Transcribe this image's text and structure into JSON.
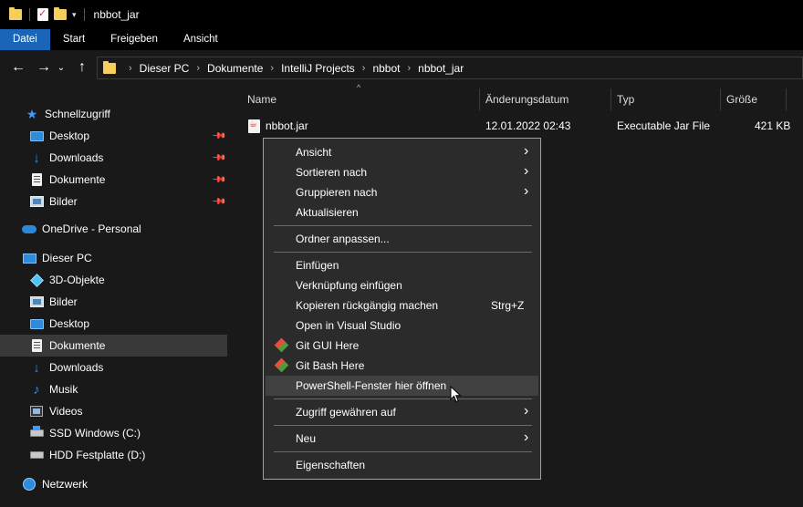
{
  "window": {
    "title": "nbbot_jar"
  },
  "ribbon": {
    "tabs": [
      "Datei",
      "Start",
      "Freigeben",
      "Ansicht"
    ]
  },
  "address": {
    "crumbs": [
      "Dieser PC",
      "Dokumente",
      "IntelliJ Projects",
      "nbbot",
      "nbbot_jar"
    ]
  },
  "sidebar": {
    "quick_access": "Schnellzugriff",
    "quick_items": [
      "Desktop",
      "Downloads",
      "Dokumente",
      "Bilder"
    ],
    "onedrive": "OneDrive - Personal",
    "this_pc": "Dieser PC",
    "pc_items": [
      "3D-Objekte",
      "Bilder",
      "Desktop",
      "Dokumente",
      "Downloads",
      "Musik",
      "Videos",
      "SSD Windows (C:)",
      "HDD Festplatte (D:)"
    ],
    "network": "Netzwerk",
    "selected": "Dokumente"
  },
  "columns": {
    "name": "Name",
    "date": "Änderungsdatum",
    "type": "Typ",
    "size": "Größe"
  },
  "files": [
    {
      "name": "nbbot.jar",
      "date": "12.01.2022 02:43",
      "type": "Executable Jar File",
      "size": "421 KB"
    }
  ],
  "context_menu": {
    "ansicht": "Ansicht",
    "sortieren": "Sortieren nach",
    "gruppieren": "Gruppieren nach",
    "aktualisieren": "Aktualisieren",
    "ordner_anpassen": "Ordner anpassen...",
    "einfuegen": "Einfügen",
    "verknuepfung": "Verknüpfung einfügen",
    "kopieren_rueck": "Kopieren rückgängig machen",
    "kopieren_rueck_shortcut": "Strg+Z",
    "open_vs": "Open in Visual Studio",
    "git_gui": "Git GUI Here",
    "git_bash": "Git Bash Here",
    "powershell": "PowerShell-Fenster hier öffnen",
    "zugriff": "Zugriff gewähren auf",
    "neu": "Neu",
    "eigenschaften": "Eigenschaften"
  },
  "colors": {
    "accent": "#1a65b7",
    "background": "#191919",
    "menu_bg": "#2b2b2b"
  }
}
